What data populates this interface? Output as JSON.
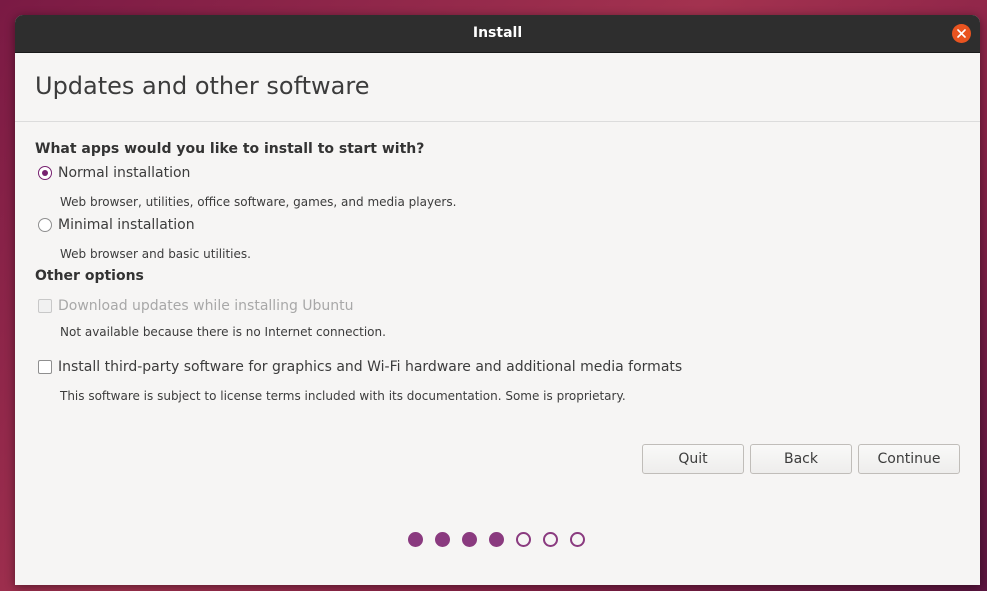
{
  "window": {
    "title": "Install"
  },
  "page": {
    "title": "Updates and other software"
  },
  "apps_section": {
    "heading": "What apps would you like to install to start with?",
    "options": [
      {
        "label": "Normal installation",
        "description": "Web browser, utilities, office software, games, and media players.",
        "selected": true
      },
      {
        "label": "Minimal installation",
        "description": "Web browser and basic utilities.",
        "selected": false
      }
    ]
  },
  "other_section": {
    "heading": "Other options",
    "options": [
      {
        "label": "Download updates while installing Ubuntu",
        "description": "Not available because there is no Internet connection.",
        "checked": false,
        "disabled": true
      },
      {
        "label": "Install third-party software for graphics and Wi-Fi hardware and additional media formats",
        "description": "This software is subject to license terms included with its documentation. Some is proprietary.",
        "checked": false,
        "disabled": false
      }
    ]
  },
  "buttons": {
    "quit": "Quit",
    "back": "Back",
    "continue": "Continue"
  },
  "progress": {
    "total_steps": 7,
    "completed_steps": 4
  },
  "colors": {
    "accent": "#77216f",
    "close": "#e95420",
    "titlebar": "#2e2e2e"
  },
  "icons": {
    "close": "close-icon"
  }
}
